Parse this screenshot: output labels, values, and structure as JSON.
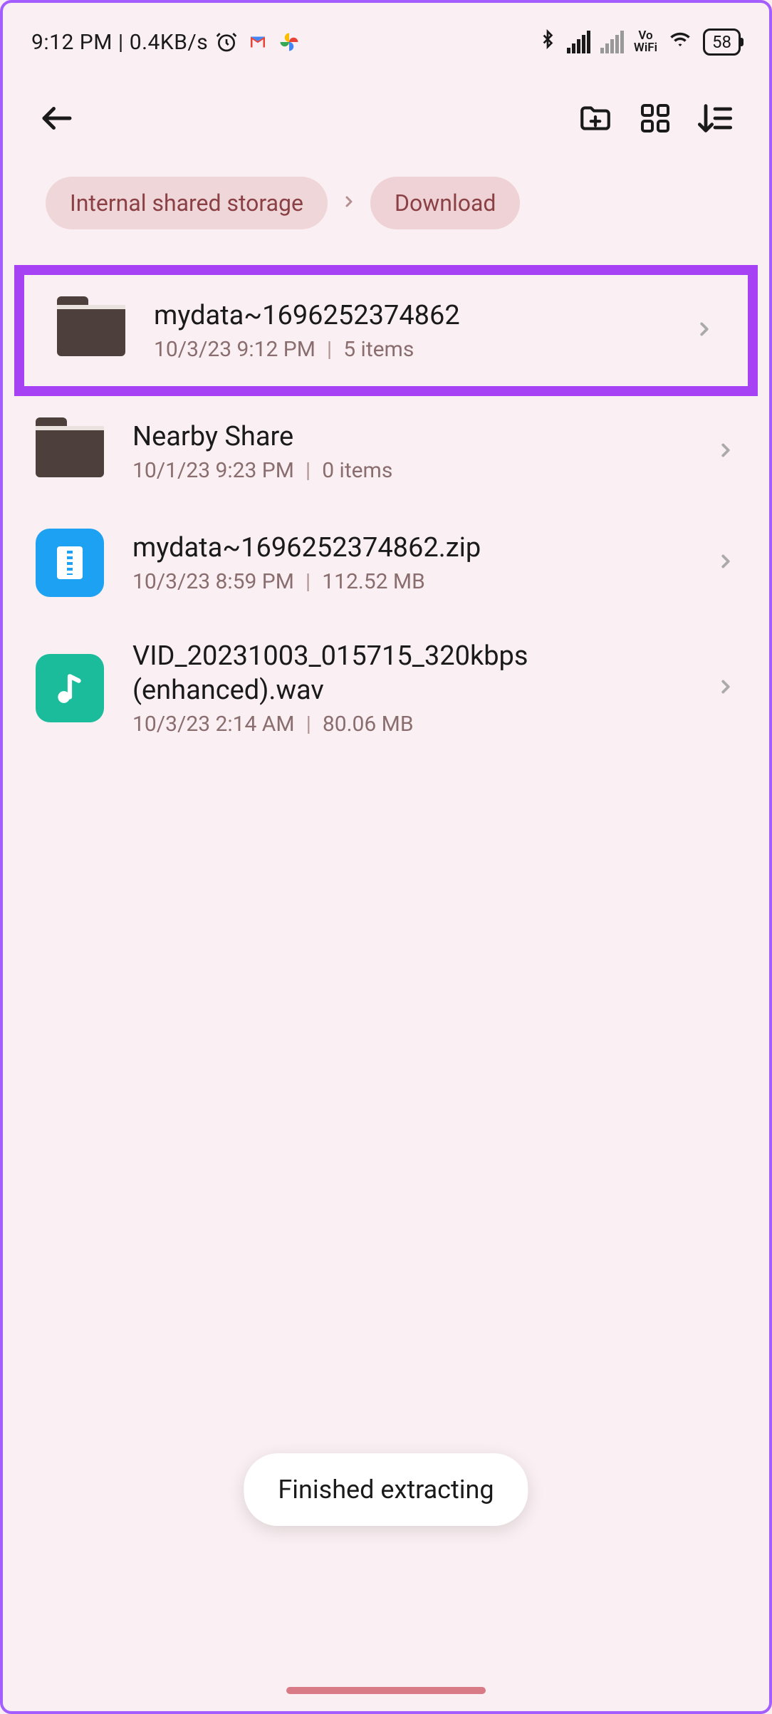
{
  "status_bar": {
    "time": "9:12 PM",
    "data_rate": "0.4KB/s",
    "battery_percent": "58",
    "vowifi_top": "Vo",
    "vowifi_bottom": "WiFi"
  },
  "breadcrumbs": {
    "root": "Internal shared storage",
    "current": "Download"
  },
  "files": [
    {
      "name": "mydata~1696252374862",
      "date": "10/3/23 9:12 PM",
      "meta": "5 items",
      "type": "folder",
      "highlighted": true
    },
    {
      "name": "Nearby Share",
      "date": "10/1/23 9:23 PM",
      "meta": "0 items",
      "type": "folder"
    },
    {
      "name": "mydata~1696252374862.zip",
      "date": "10/3/23 8:59 PM",
      "meta": "112.52 MB",
      "type": "zip"
    },
    {
      "name": "VID_20231003_015715_320kbps (enhanced).wav",
      "date": "10/3/23 2:14 AM",
      "meta": "80.06 MB",
      "type": "audio"
    }
  ],
  "toast": {
    "message": "Finished extracting"
  }
}
